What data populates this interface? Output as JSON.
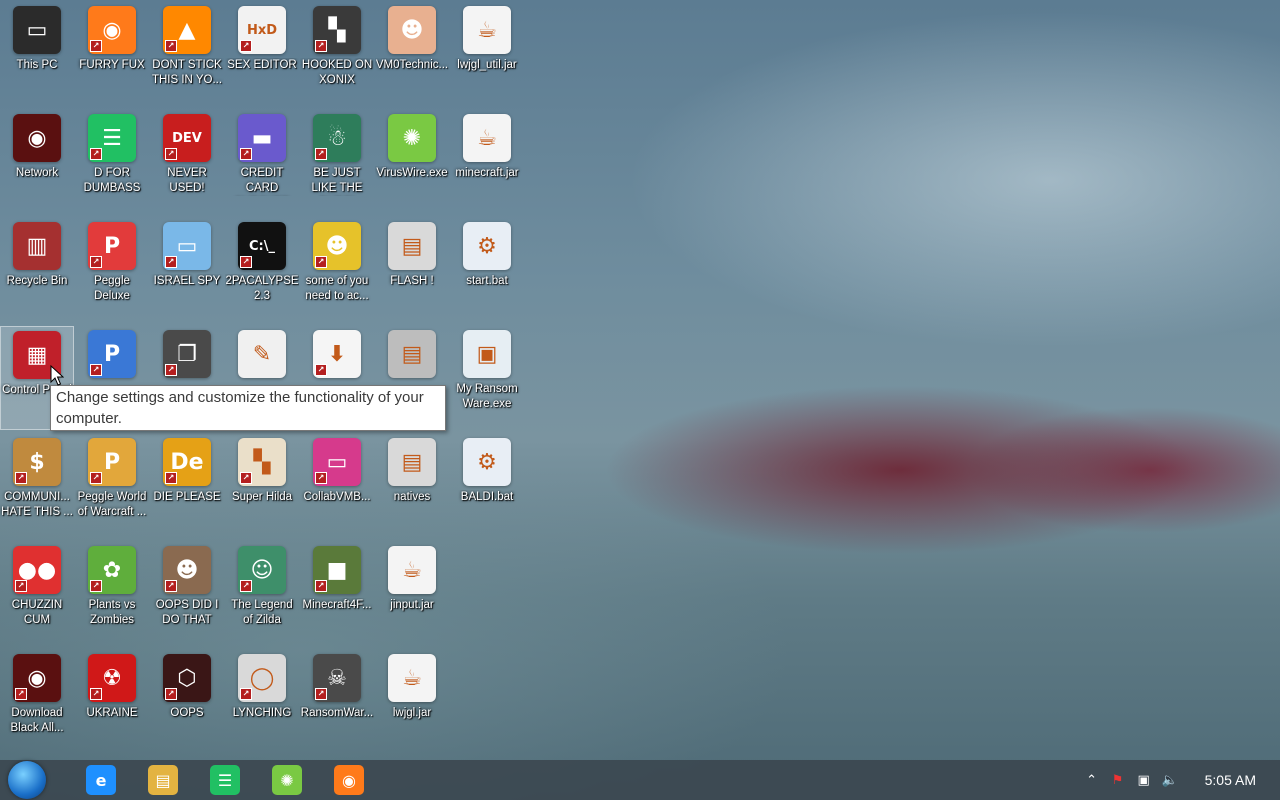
{
  "desktop": {
    "icons": [
      {
        "label": "This PC",
        "icon": "computer-icon",
        "color": "#2b2b2b",
        "glyph": "▭",
        "shortcut": false
      },
      {
        "label": "FURRY FUX",
        "icon": "firefox-icon",
        "color": "#ff7a1a",
        "glyph": "◉",
        "shortcut": true
      },
      {
        "label": "DONT STICK THIS IN YO...",
        "icon": "vlc-cone-icon",
        "color": "#ff8800",
        "glyph": "▲",
        "shortcut": true
      },
      {
        "label": "SEX EDITOR",
        "icon": "hex-editor-icon",
        "color": "#f2f2f2",
        "glyph": "HxD",
        "shortcut": true
      },
      {
        "label": "HOOKED ON XONIX",
        "icon": "xonix-game-icon",
        "color": "#3a3a3a",
        "glyph": "▚",
        "shortcut": true
      },
      {
        "label": "VM0Technic...",
        "icon": "doctor-icon",
        "color": "#e8b090",
        "glyph": "☻",
        "shortcut": false
      },
      {
        "label": "lwjgl_util.jar",
        "icon": "java-icon",
        "color": "#f4f4f4",
        "glyph": "☕",
        "shortcut": false
      },
      {
        "label": "Network",
        "icon": "network-icon",
        "color": "#5a1010",
        "glyph": "◉",
        "shortcut": false
      },
      {
        "label": "D FOR DUMBASS",
        "icon": "chat-app-icon",
        "color": "#21c063",
        "glyph": "☰",
        "shortcut": true
      },
      {
        "label": "NEVER USED!",
        "icon": "dev-cpp-icon",
        "color": "#c81e1e",
        "glyph": "DEV",
        "shortcut": true
      },
      {
        "label": "CREDIT CARD CHECKER",
        "icon": "credit-card-icon",
        "color": "#6a5acd",
        "glyph": "▬",
        "shortcut": true
      },
      {
        "label": "BE JUST LIKE THE DUDE!",
        "icon": "santa-icon",
        "color": "#2e7d5b",
        "glyph": "☃",
        "shortcut": true
      },
      {
        "label": "VirusWire.exe",
        "icon": "limewire-icon",
        "color": "#7ac943",
        "glyph": "✺",
        "shortcut": false
      },
      {
        "label": "minecraft.jar",
        "icon": "java-icon",
        "color": "#f4f4f4",
        "glyph": "☕",
        "shortcut": false
      },
      {
        "label": "Recycle Bin",
        "icon": "recycle-bin-icon",
        "color": "#a53030",
        "glyph": "▥",
        "shortcut": false
      },
      {
        "label": "Peggle Deluxe",
        "icon": "peggle-icon",
        "color": "#e23b3b",
        "glyph": "P",
        "shortcut": true
      },
      {
        "label": "ISRAEL SPY",
        "icon": "network-drive-icon",
        "color": "#7ab8e8",
        "glyph": "▭",
        "shortcut": true
      },
      {
        "label": "2PACALYPSE 2.3",
        "icon": "console-icon",
        "color": "#111111",
        "glyph": "C:\\_",
        "shortcut": true
      },
      {
        "label": "some of you need to ac...",
        "icon": "beaver-icon",
        "color": "#e6c22a",
        "glyph": "☻",
        "shortcut": true
      },
      {
        "label": "FLASH !",
        "icon": "winrar-icon",
        "color": "#d9d9d9",
        "glyph": "▤",
        "shortcut": false
      },
      {
        "label": "start.bat",
        "icon": "gear-batch-icon",
        "color": "#e8eef5",
        "glyph": "⚙",
        "shortcut": false
      },
      {
        "label": "Control Panel",
        "icon": "control-panel-icon",
        "color": "#c0202a",
        "glyph": "▦",
        "shortcut": false
      },
      {
        "label": "",
        "icon": "peggle-nights-icon",
        "color": "#3a78d6",
        "glyph": "P",
        "shortcut": true
      },
      {
        "label": "",
        "icon": "layers-icon",
        "color": "#4a4a4a",
        "glyph": "❐",
        "shortcut": true
      },
      {
        "label": "",
        "icon": "document-icon",
        "color": "#f0f0f0",
        "glyph": "✎",
        "shortcut": false
      },
      {
        "label": "",
        "icon": "fractal-icon",
        "color": "#f5f5f5",
        "glyph": "⬇",
        "shortcut": true
      },
      {
        "label": "",
        "icon": "winrar-icon",
        "color": "#bdbdbd",
        "glyph": "▤",
        "shortcut": false
      },
      {
        "label": "My Ransom Ware.exe",
        "icon": "window-app-icon",
        "color": "#e6eef3",
        "glyph": "▣",
        "shortcut": false
      },
      {
        "label": "COMMUNI... HATE THIS ...",
        "icon": "money-bag-icon",
        "color": "#c08a3e",
        "glyph": "$",
        "shortcut": true
      },
      {
        "label": "Peggle World of Warcraft ...",
        "icon": "peggle-icon",
        "color": "#e2a73b",
        "glyph": "P",
        "shortcut": true
      },
      {
        "label": "DIE PLEASE",
        "icon": "de-icon",
        "color": "#e5a116",
        "glyph": "De",
        "shortcut": true
      },
      {
        "label": "Super Hilda",
        "icon": "pixel-dog-icon",
        "color": "#eadfc9",
        "glyph": "▚",
        "shortcut": true
      },
      {
        "label": "CollabVMB...",
        "icon": "monitor-icon",
        "color": "#d63a8c",
        "glyph": "▭",
        "shortcut": true
      },
      {
        "label": "natives",
        "icon": "winrar-icon",
        "color": "#d9d9d9",
        "glyph": "▤",
        "shortcut": false
      },
      {
        "label": "BALDI.bat",
        "icon": "gear-batch-icon",
        "color": "#e8eef5",
        "glyph": "⚙",
        "shortcut": false
      },
      {
        "label": "CHUZZIN CUM",
        "icon": "chuzzle-icon",
        "color": "#e03030",
        "glyph": "●●",
        "shortcut": true
      },
      {
        "label": "Plants vs Zombies",
        "icon": "flower-icon",
        "color": "#5fae3c",
        "glyph": "✿",
        "shortcut": true
      },
      {
        "label": "OOPS DID I DO THAT",
        "icon": "portrait-icon",
        "color": "#8a6a50",
        "glyph": "☻",
        "shortcut": true
      },
      {
        "label": "The Legend of Zilda",
        "icon": "link-hero-icon",
        "color": "#3e8f6a",
        "glyph": "☺",
        "shortcut": true
      },
      {
        "label": "Minecraft4F...",
        "icon": "grass-block-icon",
        "color": "#5a7a3a",
        "glyph": "■",
        "shortcut": true
      },
      {
        "label": "jinput.jar",
        "icon": "java-icon",
        "color": "#f4f4f4",
        "glyph": "☕",
        "shortcut": false
      },
      {
        "label": "Download Black All...",
        "icon": "alien-icon",
        "color": "#5a1010",
        "glyph": "◉",
        "shortcut": true
      },
      {
        "label": "UKRAINE",
        "icon": "radiation-icon",
        "color": "#d01818",
        "glyph": "☢",
        "shortcut": true
      },
      {
        "label": "OOPS",
        "icon": "shield-game-icon",
        "color": "#3a1616",
        "glyph": "⬡",
        "shortcut": true
      },
      {
        "label": "LYNCHING",
        "icon": "noose-icon",
        "color": "#d9d9d9",
        "glyph": "◯",
        "shortcut": true
      },
      {
        "label": "RansomWar...",
        "icon": "skull-icon",
        "color": "#4a4a4a",
        "glyph": "☠",
        "shortcut": true
      },
      {
        "label": "lwjgl.jar",
        "icon": "java-icon",
        "color": "#f4f4f4",
        "glyph": "☕",
        "shortcut": false
      }
    ]
  },
  "tooltip": {
    "text": "Change settings and customize the functionality of your computer."
  },
  "taskbar": {
    "apps": [
      {
        "icon": "internet-explorer-icon",
        "color": "#1e90ff",
        "glyph": "e"
      },
      {
        "icon": "file-explorer-icon",
        "color": "#e3b341",
        "glyph": "▤"
      },
      {
        "icon": "chat-app-icon",
        "color": "#21c063",
        "glyph": "☰"
      },
      {
        "icon": "limewire-icon",
        "color": "#7ac943",
        "glyph": "✺"
      },
      {
        "icon": "firefox-icon",
        "color": "#ff7a1a",
        "glyph": "◉"
      }
    ],
    "tray": {
      "chevron": "⌃",
      "flag": "⚑",
      "network": "▣",
      "volume": "🔈",
      "time": "5:05 AM"
    }
  }
}
